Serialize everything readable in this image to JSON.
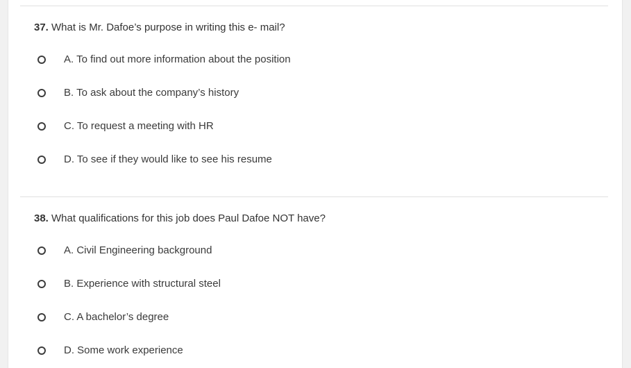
{
  "questions": [
    {
      "number": "37.",
      "text": " What is Mr. Dafoe’s purpose in writing this e- mail?",
      "options": [
        "A. To find out more information about the position",
        "B. To ask about the company’s history",
        "C. To request a meeting with HR",
        "D. To see if they would like to see his resume"
      ]
    },
    {
      "number": "38.",
      "text": " What qualifications for this job does Paul Dafoe NOT have?",
      "options": [
        "A. Civil Engineering background",
        "B. Experience with structural steel",
        "C. A bachelor’s degree",
        "D. Some work experience"
      ]
    }
  ]
}
